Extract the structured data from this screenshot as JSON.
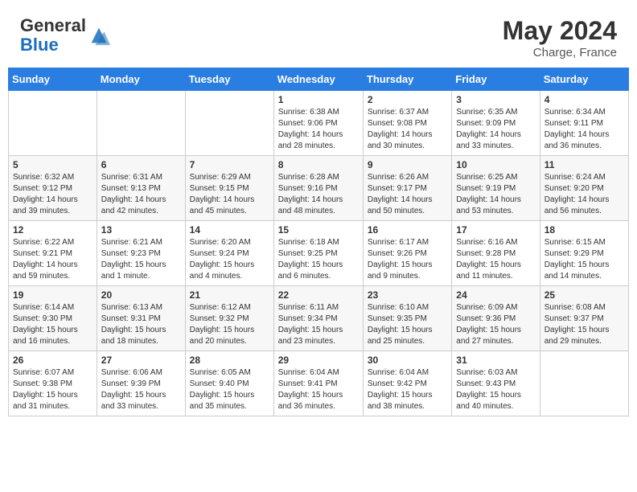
{
  "header": {
    "logo_general": "General",
    "logo_blue": "Blue",
    "month_year": "May 2024",
    "location": "Charge, France"
  },
  "days_of_week": [
    "Sunday",
    "Monday",
    "Tuesday",
    "Wednesday",
    "Thursday",
    "Friday",
    "Saturday"
  ],
  "weeks": [
    [
      {
        "day": "",
        "content": ""
      },
      {
        "day": "",
        "content": ""
      },
      {
        "day": "",
        "content": ""
      },
      {
        "day": "1",
        "content": "Sunrise: 6:38 AM\nSunset: 9:06 PM\nDaylight: 14 hours\nand 28 minutes."
      },
      {
        "day": "2",
        "content": "Sunrise: 6:37 AM\nSunset: 9:08 PM\nDaylight: 14 hours\nand 30 minutes."
      },
      {
        "day": "3",
        "content": "Sunrise: 6:35 AM\nSunset: 9:09 PM\nDaylight: 14 hours\nand 33 minutes."
      },
      {
        "day": "4",
        "content": "Sunrise: 6:34 AM\nSunset: 9:11 PM\nDaylight: 14 hours\nand 36 minutes."
      }
    ],
    [
      {
        "day": "5",
        "content": "Sunrise: 6:32 AM\nSunset: 9:12 PM\nDaylight: 14 hours\nand 39 minutes."
      },
      {
        "day": "6",
        "content": "Sunrise: 6:31 AM\nSunset: 9:13 PM\nDaylight: 14 hours\nand 42 minutes."
      },
      {
        "day": "7",
        "content": "Sunrise: 6:29 AM\nSunset: 9:15 PM\nDaylight: 14 hours\nand 45 minutes."
      },
      {
        "day": "8",
        "content": "Sunrise: 6:28 AM\nSunset: 9:16 PM\nDaylight: 14 hours\nand 48 minutes."
      },
      {
        "day": "9",
        "content": "Sunrise: 6:26 AM\nSunset: 9:17 PM\nDaylight: 14 hours\nand 50 minutes."
      },
      {
        "day": "10",
        "content": "Sunrise: 6:25 AM\nSunset: 9:19 PM\nDaylight: 14 hours\nand 53 minutes."
      },
      {
        "day": "11",
        "content": "Sunrise: 6:24 AM\nSunset: 9:20 PM\nDaylight: 14 hours\nand 56 minutes."
      }
    ],
    [
      {
        "day": "12",
        "content": "Sunrise: 6:22 AM\nSunset: 9:21 PM\nDaylight: 14 hours\nand 59 minutes."
      },
      {
        "day": "13",
        "content": "Sunrise: 6:21 AM\nSunset: 9:23 PM\nDaylight: 15 hours\nand 1 minute."
      },
      {
        "day": "14",
        "content": "Sunrise: 6:20 AM\nSunset: 9:24 PM\nDaylight: 15 hours\nand 4 minutes."
      },
      {
        "day": "15",
        "content": "Sunrise: 6:18 AM\nSunset: 9:25 PM\nDaylight: 15 hours\nand 6 minutes."
      },
      {
        "day": "16",
        "content": "Sunrise: 6:17 AM\nSunset: 9:26 PM\nDaylight: 15 hours\nand 9 minutes."
      },
      {
        "day": "17",
        "content": "Sunrise: 6:16 AM\nSunset: 9:28 PM\nDaylight: 15 hours\nand 11 minutes."
      },
      {
        "day": "18",
        "content": "Sunrise: 6:15 AM\nSunset: 9:29 PM\nDaylight: 15 hours\nand 14 minutes."
      }
    ],
    [
      {
        "day": "19",
        "content": "Sunrise: 6:14 AM\nSunset: 9:30 PM\nDaylight: 15 hours\nand 16 minutes."
      },
      {
        "day": "20",
        "content": "Sunrise: 6:13 AM\nSunset: 9:31 PM\nDaylight: 15 hours\nand 18 minutes."
      },
      {
        "day": "21",
        "content": "Sunrise: 6:12 AM\nSunset: 9:32 PM\nDaylight: 15 hours\nand 20 minutes."
      },
      {
        "day": "22",
        "content": "Sunrise: 6:11 AM\nSunset: 9:34 PM\nDaylight: 15 hours\nand 23 minutes."
      },
      {
        "day": "23",
        "content": "Sunrise: 6:10 AM\nSunset: 9:35 PM\nDaylight: 15 hours\nand 25 minutes."
      },
      {
        "day": "24",
        "content": "Sunrise: 6:09 AM\nSunset: 9:36 PM\nDaylight: 15 hours\nand 27 minutes."
      },
      {
        "day": "25",
        "content": "Sunrise: 6:08 AM\nSunset: 9:37 PM\nDaylight: 15 hours\nand 29 minutes."
      }
    ],
    [
      {
        "day": "26",
        "content": "Sunrise: 6:07 AM\nSunset: 9:38 PM\nDaylight: 15 hours\nand 31 minutes."
      },
      {
        "day": "27",
        "content": "Sunrise: 6:06 AM\nSunset: 9:39 PM\nDaylight: 15 hours\nand 33 minutes."
      },
      {
        "day": "28",
        "content": "Sunrise: 6:05 AM\nSunset: 9:40 PM\nDaylight: 15 hours\nand 35 minutes."
      },
      {
        "day": "29",
        "content": "Sunrise: 6:04 AM\nSunset: 9:41 PM\nDaylight: 15 hours\nand 36 minutes."
      },
      {
        "day": "30",
        "content": "Sunrise: 6:04 AM\nSunset: 9:42 PM\nDaylight: 15 hours\nand 38 minutes."
      },
      {
        "day": "31",
        "content": "Sunrise: 6:03 AM\nSunset: 9:43 PM\nDaylight: 15 hours\nand 40 minutes."
      },
      {
        "day": "",
        "content": ""
      }
    ]
  ]
}
